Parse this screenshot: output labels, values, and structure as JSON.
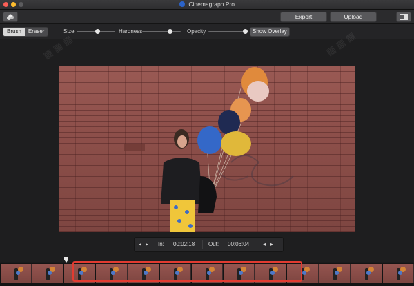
{
  "window": {
    "title": "Cinemagraph Pro"
  },
  "toolbar": {
    "export_label": "Export",
    "upload_label": "Upload"
  },
  "mask_tools": {
    "modes": [
      "Brush",
      "Eraser"
    ],
    "active_mode": "Brush",
    "size_label": "Size",
    "size_value": 0.55,
    "hardness_label": "Hardness",
    "hardness_value": 0.72,
    "opacity_label": "Opacity",
    "opacity_value": 0.95,
    "overlay_label": "Show Overlay"
  },
  "transport": {
    "in_label": "In:",
    "in_time": "00:02:18",
    "out_label": "Out:",
    "out_time": "00:06:04"
  },
  "filmstrip": {
    "frame_count": 13
  },
  "colors": {
    "selection": "#e23b31",
    "accent": "#2b63c9"
  },
  "icons": [
    "app-icon",
    "share-icon",
    "panel-icon",
    "step-left-icon",
    "step-right-icon",
    "playhead-icon"
  ]
}
